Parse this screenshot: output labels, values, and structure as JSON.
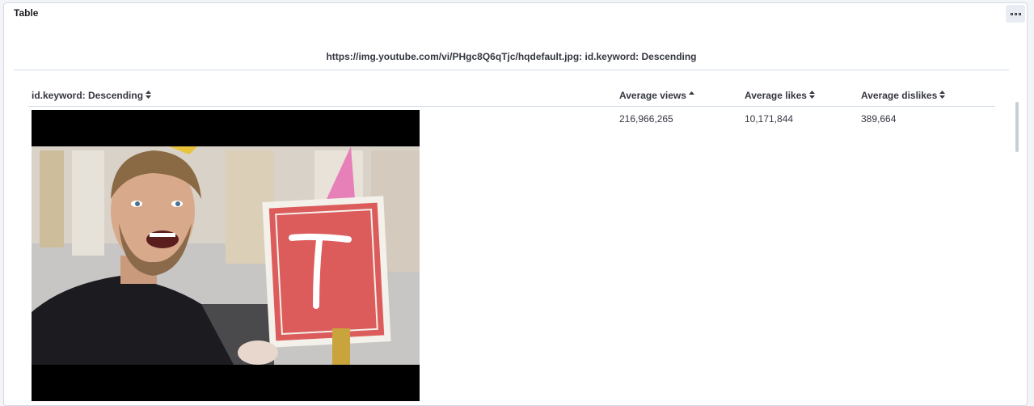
{
  "panel": {
    "title": "Table",
    "options_icon": "dots-icon"
  },
  "split": {
    "title": "https://img.youtube.com/vi/PHgc8Q6qTjc/hqdefault.jpg: id.keyword: Descending"
  },
  "table": {
    "columns": [
      {
        "label": "id.keyword: Descending",
        "sort": "both"
      },
      {
        "label": "Average views",
        "sort": "asc"
      },
      {
        "label": "Average likes",
        "sort": "both"
      },
      {
        "label": "Average dislikes",
        "sort": "both"
      }
    ],
    "rows": [
      {
        "thumbnail": "youtube-thumbnail-image",
        "views": "216,966,265",
        "likes": "10,171,844",
        "dislikes": "389,664"
      }
    ]
  },
  "colors": {
    "background": "#f3f4f7",
    "panel": "#ffffff",
    "border": "#d3dae6",
    "text": "#343741"
  }
}
